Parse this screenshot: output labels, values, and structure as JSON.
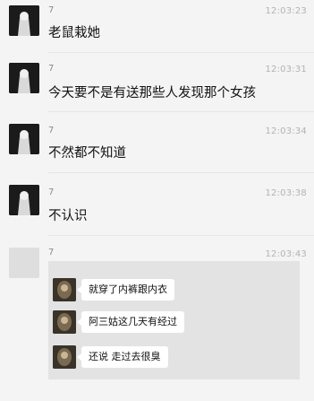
{
  "messages": [
    {
      "sender": "7",
      "time": "12:03:23",
      "text": "老鼠栽她"
    },
    {
      "sender": "7",
      "time": "12:03:31",
      "text": "今天要不是有送那些人发现那个女孩"
    },
    {
      "sender": "7",
      "time": "12:03:34",
      "text": "不然都不知道"
    },
    {
      "sender": "7",
      "time": "12:03:38",
      "text": "不认识"
    },
    {
      "sender": "7",
      "time": "12:03:43"
    }
  ],
  "embedded_chat": {
    "bubbles": [
      "就穿了内裤跟内衣",
      "阿三姑这几天有经过",
      "还说 走过去很臭"
    ]
  },
  "colors": {
    "page_bg": "#f4f4f4",
    "embedded_bg": "#e3e3e3",
    "bubble_bg": "#ffffff"
  }
}
